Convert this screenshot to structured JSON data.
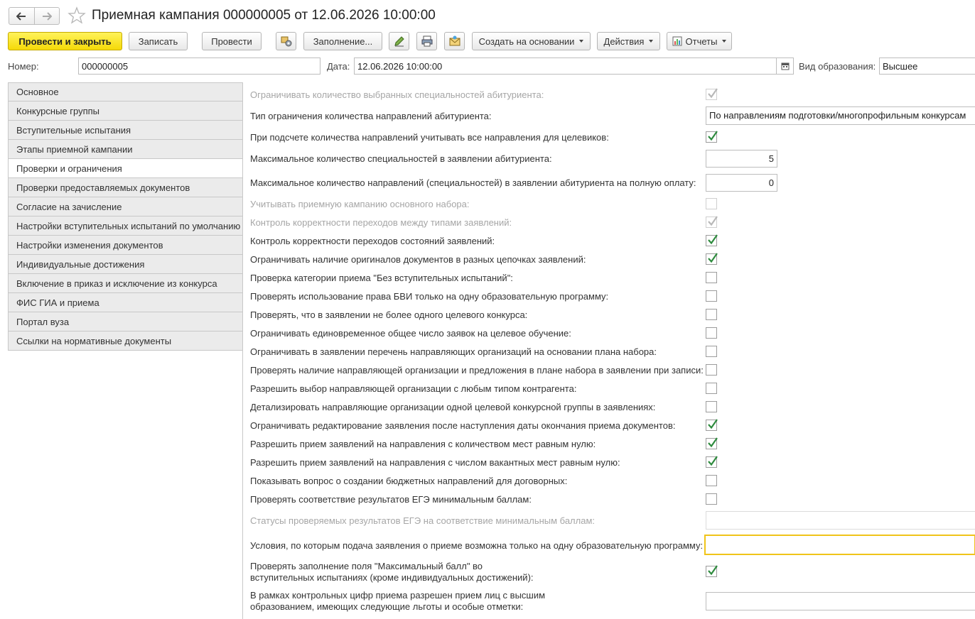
{
  "title": "Приемная кампания 000000005 от 12.06.2026 10:00:00",
  "toolbar": {
    "post_close": "Провести и закрыть",
    "save": "Записать",
    "post": "Провести",
    "fill": "Заполнение...",
    "create_based": "Создать на основании",
    "actions": "Действия",
    "reports": "Отчеты"
  },
  "header": {
    "number_label": "Номер:",
    "number_value": "000000005",
    "date_label": "Дата:",
    "date_value": "12.06.2026 10:00:00",
    "edu_label": "Вид образования:",
    "edu_value": "Высшее"
  },
  "nav": [
    "Основное",
    "Конкурсные группы",
    "Вступительные испытания",
    "Этапы приемной кампании",
    "Проверки и ограничения",
    "Проверки предоставляемых документов",
    "Согласие на зачисление",
    "Настройки вступительных испытаний по умолчанию",
    "Настройки изменения документов",
    "Индивидуальные достижения",
    "Включение в приказ и исключение из конкурса",
    "ФИС ГИА и приема",
    "Портал вуза",
    "Ссылки на нормативные документы"
  ],
  "nav_active_index": 4,
  "rows": {
    "r01": {
      "label": "Ограничивать количество выбранных специальностей абитуриента:",
      "checked": true,
      "disabled": true
    },
    "r02": {
      "label": "Тип ограничения количества направлений абитуриента:",
      "value": "По направлениям подготовки/многопрофильным конкурсам"
    },
    "r03": {
      "label": "При подсчете количества направлений учитывать все направления для целевиков:",
      "checked": true
    },
    "r04": {
      "label": "Максимальное количество специальностей в заявлении абитуриента:",
      "value": "5"
    },
    "r05": {
      "label": "Максимальное количество направлений (специальностей) в заявлении абитуриента на полную оплату:",
      "value": "0"
    },
    "r06": {
      "label": "Учитывать приемную кампанию основного набора:",
      "checked": false,
      "disabled": true
    },
    "r07": {
      "label": "Контроль корректности переходов между типами заявлений:",
      "checked": true,
      "disabled": true
    },
    "r08": {
      "label": "Контроль корректности переходов состояний заявлений:",
      "checked": true
    },
    "r09": {
      "label": "Ограничивать наличие оригиналов документов в разных цепочках заявлений:",
      "checked": true
    },
    "r10": {
      "label": "Проверка категории приема \"Без вступительных испытаний\":",
      "checked": false
    },
    "r11": {
      "label": "Проверять использование права БВИ только на одну образовательную программу:",
      "checked": false
    },
    "r12": {
      "label": "Проверять, что в заявлении не более одного целевого конкурса:",
      "checked": false
    },
    "r13": {
      "label": "Ограничивать единовременное общее число заявок на целевое обучение:",
      "checked": false
    },
    "r14": {
      "label": "Ограничивать в заявлении перечень направляющих организаций на основании плана набора:",
      "checked": false
    },
    "r15": {
      "label": "Проверять наличие направляющей организации и предложения в плане набора в заявлении при записи:",
      "checked": false
    },
    "r16": {
      "label": "Разрешить выбор направляющей организации с любым типом контрагента:",
      "checked": false
    },
    "r17": {
      "label": "Детализировать направляющие организации одной целевой конкурсной группы в заявлениях:",
      "checked": false
    },
    "r18": {
      "label": "Ограничивать редактирование заявления после наступления даты окончания приема документов:",
      "checked": true
    },
    "r19": {
      "label": "Разрешить прием заявлений на направления с количеством мест равным нулю:",
      "checked": true
    },
    "r20": {
      "label": "Разрешить прием заявлений на направления с числом вакантных мест равным нулю:",
      "checked": true
    },
    "r21": {
      "label": "Показывать вопрос о создании бюджетных направлений для договорных:",
      "checked": false
    },
    "r22": {
      "label": "Проверять соответствие результатов ЕГЭ минимальным баллам:",
      "checked": false
    },
    "r23": {
      "label": "Статусы проверяемых результатов ЕГЭ на соответствие минимальным баллам:",
      "value": "",
      "disabled": true
    },
    "r24": {
      "label": "Условия, по которым подача заявления о приеме возможна только на одну образовательную программу:",
      "value": ""
    },
    "r25": {
      "label_1": "Проверять заполнение поля \"Максимальный балл\" во",
      "label_2": "вступительных испытаниях (кроме индивидуальных достижений):",
      "checked": true
    },
    "r26": {
      "label_1": "В рамках контрольных цифр приема разрешен прием лиц с высшим",
      "label_2": "образованием, имеющих следующие льготы и особые отметки:",
      "value": ""
    }
  },
  "colors": {
    "primary_button": "#f5d907",
    "check_green": "#2e8b3e",
    "focus_border": "#f0c419"
  }
}
